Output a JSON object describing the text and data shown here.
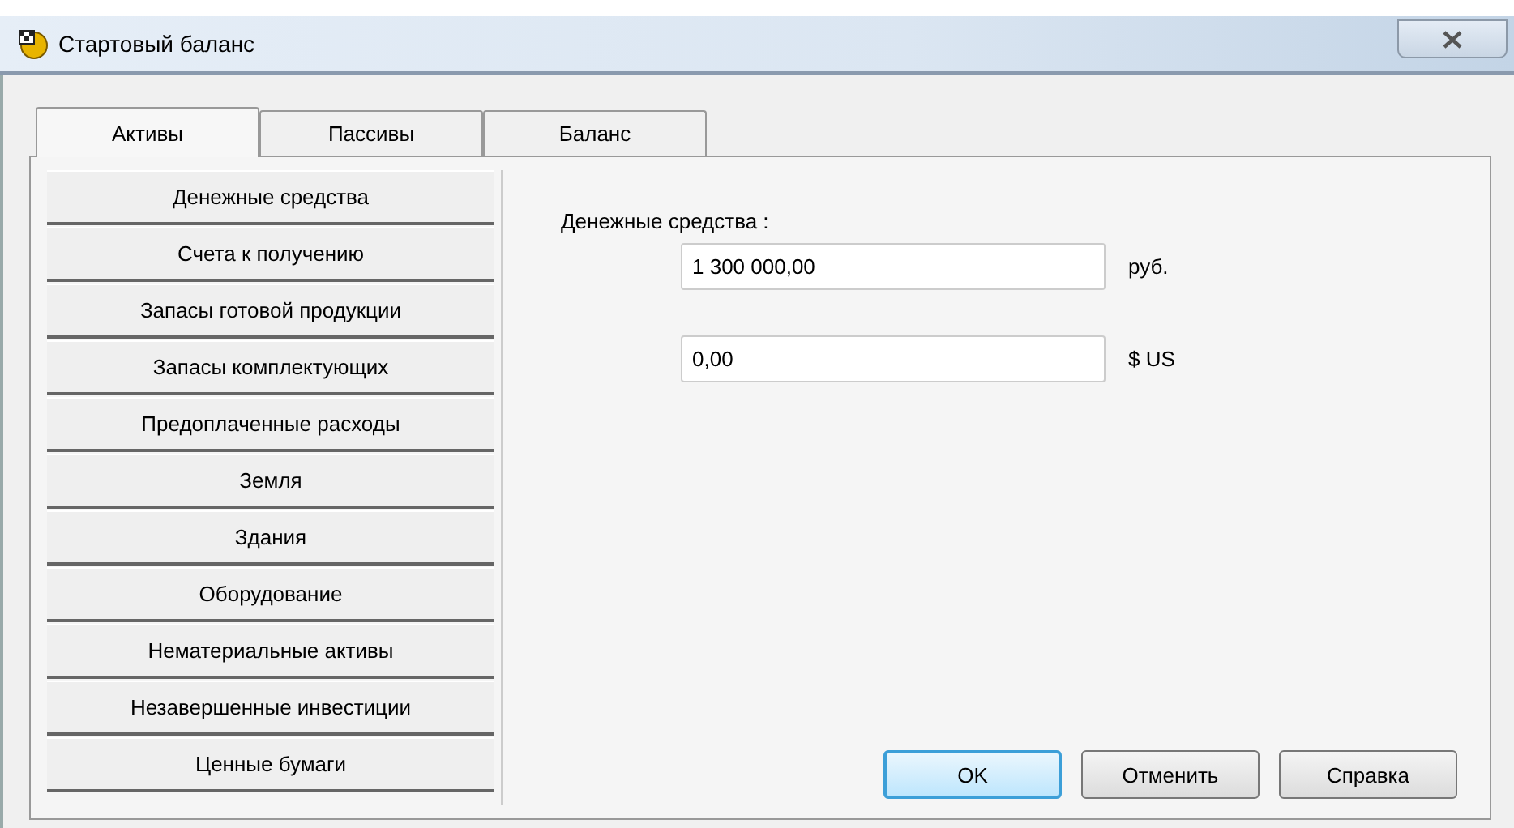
{
  "window": {
    "title": "Стартовый баланс"
  },
  "tabs": [
    {
      "label": "Активы",
      "selected": true
    },
    {
      "label": "Пассивы",
      "selected": false
    },
    {
      "label": "Баланс",
      "selected": false
    }
  ],
  "sidebar": {
    "items": [
      {
        "label": "Денежные средства"
      },
      {
        "label": "Счета к получению"
      },
      {
        "label": "Запасы готовой продукции"
      },
      {
        "label": "Запасы комплектующих"
      },
      {
        "label": "Предоплаченные расходы"
      },
      {
        "label": "Земля"
      },
      {
        "label": "Здания"
      },
      {
        "label": "Оборудование"
      },
      {
        "label": "Нематериальные активы"
      },
      {
        "label": "Незавершенные инвестиции"
      },
      {
        "label": "Ценные бумаги"
      }
    ]
  },
  "form": {
    "heading": "Денежные средства :",
    "fields": [
      {
        "value": "1 300 000,00",
        "unit": "руб."
      },
      {
        "value": "0,00",
        "unit": "$ US"
      }
    ]
  },
  "buttons": [
    {
      "label": "OK",
      "default": true
    },
    {
      "label": "Отменить",
      "default": false
    },
    {
      "label": "Справка",
      "default": false
    }
  ]
}
